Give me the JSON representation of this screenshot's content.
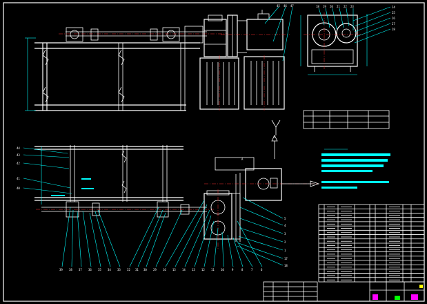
{
  "drawing": {
    "frame_color": "#ffffff",
    "leader_color": "#00ffff",
    "centerline_color": "#ff3030",
    "title_accent_colors": [
      "#ff00ff",
      "#00ff00",
      "#ffff00"
    ]
  },
  "view_labels": {
    "direction_arrow": "A",
    "top_motor_label": "A"
  },
  "balloons_top_right": [
    "18",
    "19",
    "20",
    "21",
    "22",
    "23",
    "24",
    "25",
    "26",
    "27",
    "28"
  ],
  "balloons_top_center": [
    "45",
    "46",
    "47"
  ],
  "balloons_left": [
    "44",
    "43",
    "42",
    "41",
    "40"
  ],
  "balloons_bottom": [
    "39",
    "38",
    "37",
    "36",
    "35",
    "34",
    "33",
    "32",
    "31",
    "30",
    "29",
    "16",
    "15",
    "14",
    "13",
    "12",
    "11",
    "10",
    "9",
    "8",
    "7",
    "6",
    "5",
    "4",
    "3",
    "2",
    "1"
  ],
  "balloons_right": [
    "17",
    "18"
  ]
}
